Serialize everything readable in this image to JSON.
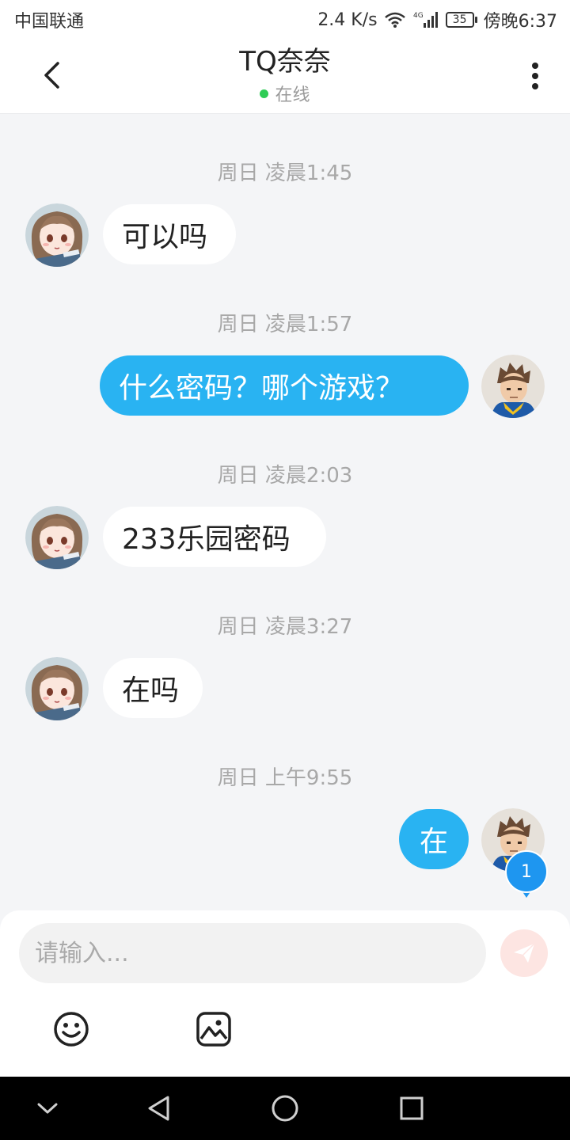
{
  "status_bar": {
    "carrier": "中国联通",
    "net_speed": "2.4 K/s",
    "network_type": "4G",
    "battery": "35",
    "time": "傍晚6:37"
  },
  "header": {
    "title": "TQ奈奈",
    "status": "在线",
    "status_color": "#2ecc55",
    "icons": [
      "back-arrow-icon",
      "more-vertical-icon"
    ]
  },
  "chat": {
    "messages": [
      {
        "timestamp": "周日 凌晨1:45",
        "sender": "other",
        "text": "可以吗"
      },
      {
        "timestamp": "周日 凌晨1:57",
        "sender": "me",
        "text": "什么密码？哪个游戏？"
      },
      {
        "timestamp": "周日 凌晨2:03",
        "sender": "other",
        "text": "233乐园密码"
      },
      {
        "timestamp": "周日 凌晨3:27",
        "sender": "other",
        "text": "在吗"
      },
      {
        "timestamp": "周日 上午9:55",
        "sender": "me",
        "text": "在"
      }
    ],
    "unread_count": "1",
    "outgoing_bubble_color": "#29b3f2",
    "incoming_bubble_color": "#ffffff"
  },
  "input": {
    "placeholder": "请输入...",
    "value": "",
    "icons": [
      "send-icon",
      "emoji-icon",
      "image-icon"
    ]
  },
  "nav_bar": {
    "icons": [
      "nav-collapse-icon",
      "nav-back-icon",
      "nav-home-icon",
      "nav-recent-icon"
    ]
  }
}
